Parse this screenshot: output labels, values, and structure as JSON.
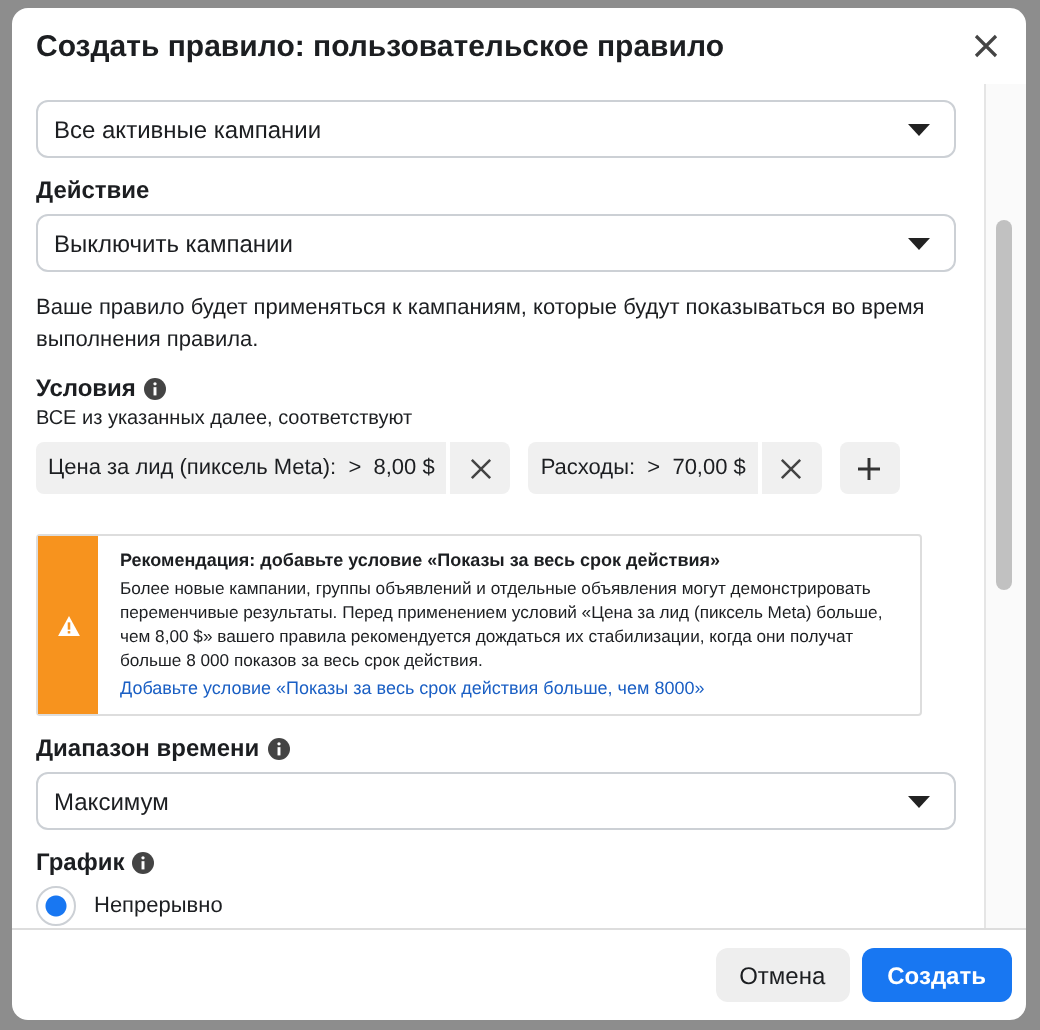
{
  "dialog": {
    "title": "Создать правило: пользовательское правило"
  },
  "sections": [
    {
      "kind": "select",
      "value": "Все активные кампании"
    },
    {
      "kind": "select",
      "label": "Действие",
      "value": "Выключить кампании"
    },
    {
      "kind": "text",
      "text": "Ваше правило будет применяться к кампаниям, которые будут показываться во время выполнения правила."
    },
    {
      "kind": "conditions",
      "label": "Условия",
      "info": true,
      "subtitle": "ВСЕ из указанных далее, соответствуют",
      "items": [
        {
          "name": "Цена за лид (пиксель Meta):",
          "operator": ">",
          "value": "8,00 $"
        },
        {
          "name": "Расходы:",
          "operator": ">",
          "value": "70,00 $"
        }
      ]
    },
    {
      "kind": "warning",
      "title": "Рекомендация: добавьте условие «Показы за весь срок действия»",
      "text": "Более новые кампании, группы объявлений и отдельные объявления могут демонстрировать переменчивые результаты. Перед применением условий «Цена за лид (пиксель Meta) больше, чем 8,00 $» вашего правила рекомендуется дождаться их стабилизации, когда они получат больше 8 000 показов за весь срок действия.",
      "link": "Добавьте условие «Показы за весь срок действия больше, чем 8000»"
    },
    {
      "kind": "select",
      "label": "Диапазон времени",
      "info": true,
      "value": "Максимум"
    },
    {
      "kind": "radio",
      "label": "График",
      "info": true,
      "options": [
        {
          "label": "Непрерывно",
          "selected": true
        }
      ]
    }
  ],
  "buttons": [
    {
      "label": "Отмена",
      "kind": "secondary"
    },
    {
      "label": "Создать",
      "kind": "primary"
    }
  ]
}
